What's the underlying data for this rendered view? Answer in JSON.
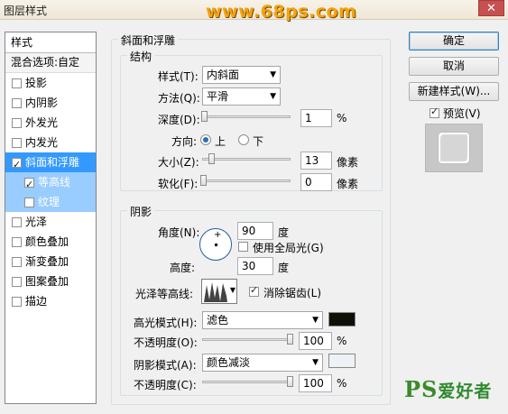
{
  "window": {
    "title": "图层样式",
    "watermark": "www.68ps.com",
    "close_label": "✕"
  },
  "sidebar": {
    "header": "样式",
    "blend": "混合选项:自定",
    "items": [
      {
        "label": "投影",
        "checked": false
      },
      {
        "label": "内阴影",
        "checked": false
      },
      {
        "label": "外发光",
        "checked": false
      },
      {
        "label": "内发光",
        "checked": false
      },
      {
        "label": "斜面和浮雕",
        "checked": true
      },
      {
        "label": "等高线",
        "checked": true
      },
      {
        "label": "纹理",
        "checked": false
      },
      {
        "label": "光泽",
        "checked": false
      },
      {
        "label": "颜色叠加",
        "checked": false
      },
      {
        "label": "渐变叠加",
        "checked": false
      },
      {
        "label": "图案叠加",
        "checked": false
      },
      {
        "label": "描边",
        "checked": false
      }
    ]
  },
  "buttons": {
    "ok": "确定",
    "cancel": "取消",
    "new_style": "新建样式(W)...",
    "preview": "预览(V)"
  },
  "bevel": {
    "title": "斜面和浮雕",
    "structure": {
      "title": "结构",
      "style_label": "样式(T):",
      "style_value": "内斜面",
      "technique_label": "方法(Q):",
      "technique_value": "平滑",
      "depth_label": "深度(D):",
      "depth_value": "1",
      "depth_unit": "%",
      "depth_fraction": 0.01,
      "direction_label": "方向:",
      "dir_up": "上",
      "dir_down": "下",
      "size_label": "大小(Z):",
      "size_value": "13",
      "size_unit": "像素",
      "soften_label": "软化(F):",
      "soften_value": "0",
      "soften_unit": "像素"
    },
    "shading": {
      "title": "阴影",
      "angle_label": "角度(N):",
      "angle_value": "90",
      "angle_unit": "度",
      "global_light": "使用全局光(G)",
      "altitude_label": "高度:",
      "altitude_value": "30",
      "altitude_unit": "度",
      "gloss_label": "光泽等高线:",
      "antialias": "消除锯齿(L)",
      "highlight_mode_label": "高光模式(H):",
      "highlight_mode_value": "滤色",
      "highlight_color": "#111008",
      "opacity1_label": "不透明度(O):",
      "opacity1_value": "100",
      "opacity1_unit": "%",
      "shadow_mode_label": "阴影模式(A):",
      "shadow_mode_value": "颜色减淡",
      "shadow_color": "#eef1f6",
      "opacity2_label": "不透明度(C):",
      "opacity2_value": "100",
      "opacity2_unit": "%"
    }
  },
  "logo": {
    "ps": "PS",
    "cn": "爱好者"
  }
}
